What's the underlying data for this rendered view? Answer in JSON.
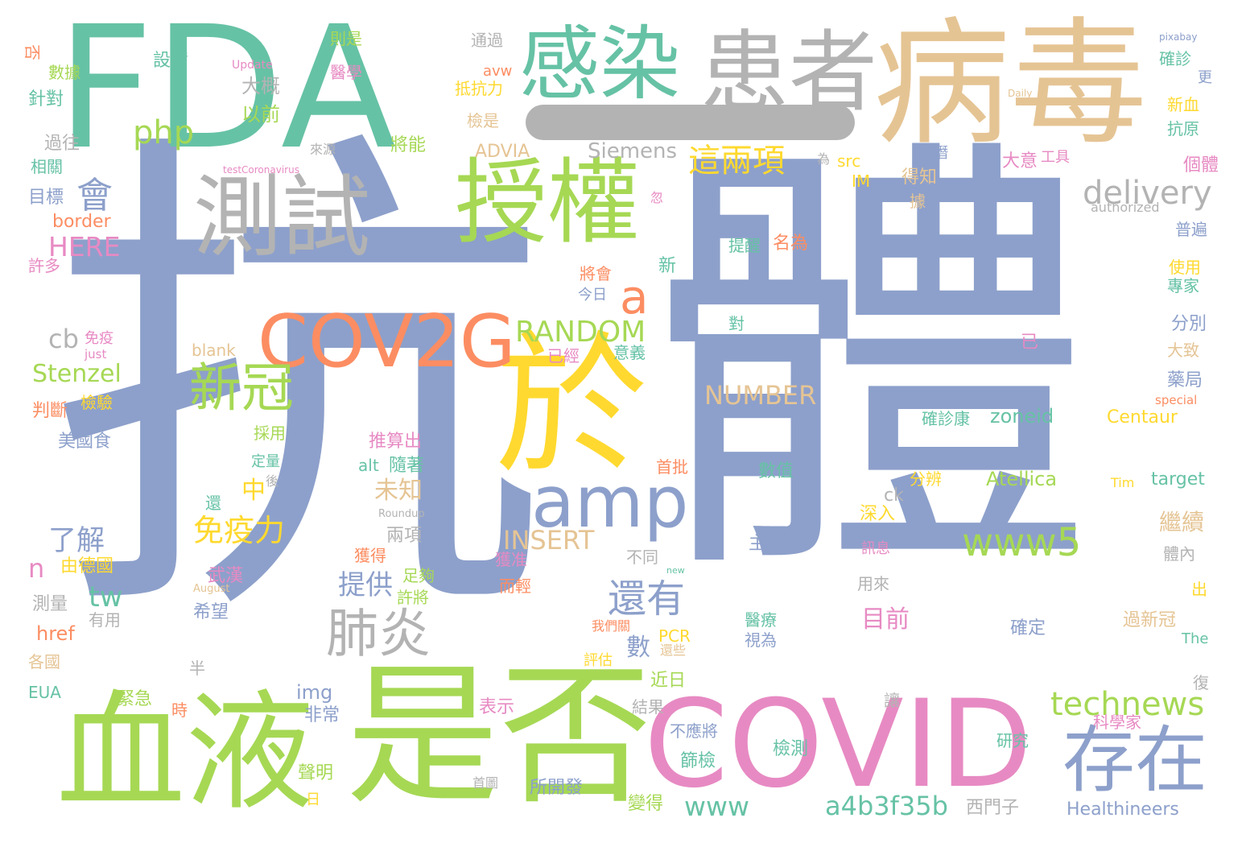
{
  "colors": {
    "blue": "#8da0cb",
    "teal": "#66c2a5",
    "tan": "#e5c494",
    "green": "#a6d854",
    "gray": "#b3b3b3",
    "yellow": "#ffd92f",
    "pink": "#e78ac3",
    "orange": "#fc8d62"
  },
  "words": [
    {
      "text": "抗",
      "color": "blue"
    },
    {
      "text": "體",
      "color": "blue"
    },
    {
      "text": "FDA",
      "color": "teal"
    },
    {
      "text": "病毒",
      "color": "tan"
    },
    {
      "text": "患者",
      "color": "gray"
    },
    {
      "text": "感染",
      "color": "teal"
    },
    {
      "text": "授權",
      "color": "green"
    },
    {
      "text": "測試",
      "color": "gray"
    },
    {
      "text": "於",
      "color": "yellow"
    },
    {
      "text": "是否",
      "color": "green"
    },
    {
      "text": "血液",
      "color": "green"
    },
    {
      "text": "COVID",
      "color": "pink"
    },
    {
      "text": "存在",
      "color": "blue"
    },
    {
      "text": "COV2G",
      "color": "orange"
    },
    {
      "text": "amp",
      "color": "blue"
    },
    {
      "text": "新冠",
      "color": "green"
    },
    {
      "text": "肺炎",
      "color": "gray"
    },
    {
      "text": "php",
      "color": "green"
    },
    {
      "text": "這兩項",
      "color": "yellow"
    },
    {
      "text": "delivery",
      "color": "gray"
    },
    {
      "text": "會",
      "color": "blue"
    },
    {
      "text": "a",
      "color": "orange"
    },
    {
      "text": "RANDOM",
      "color": "green"
    },
    {
      "text": "www5",
      "color": "green"
    },
    {
      "text": "還有",
      "color": "blue"
    },
    {
      "text": "technews",
      "color": "green"
    },
    {
      "text": "a4b3f35b",
      "color": "teal"
    },
    {
      "text": "www",
      "color": "teal"
    },
    {
      "text": "HERE",
      "color": "pink"
    },
    {
      "text": "Stenzel",
      "color": "green"
    },
    {
      "text": "NUMBER",
      "color": "tan"
    },
    {
      "text": "INSERT",
      "color": "tan"
    },
    {
      "text": "免疫力",
      "color": "yellow"
    },
    {
      "text": "提供",
      "color": "blue"
    },
    {
      "text": "未知",
      "color": "tan"
    },
    {
      "text": "目前",
      "color": "pink"
    },
    {
      "text": "繼續",
      "color": "tan"
    },
    {
      "text": "tw",
      "color": "teal"
    },
    {
      "text": "了解",
      "color": "blue"
    },
    {
      "text": "cb",
      "color": "gray"
    },
    {
      "text": "n",
      "color": "pink"
    },
    {
      "text": "數",
      "color": "blue"
    },
    {
      "text": "中",
      "color": "yellow"
    },
    {
      "text": "Siemens",
      "color": "gray"
    },
    {
      "text": "zoneid",
      "color": "teal"
    },
    {
      "text": "Centaur",
      "color": "yellow"
    },
    {
      "text": "Atellica",
      "color": "green"
    },
    {
      "text": "target",
      "color": "teal"
    },
    {
      "text": "Healthineers",
      "color": "blue"
    },
    {
      "text": "ADVIA",
      "color": "tan"
    },
    {
      "text": "border",
      "color": "orange"
    },
    {
      "text": "blank",
      "color": "tan"
    },
    {
      "text": "img",
      "color": "blue"
    },
    {
      "text": "href",
      "color": "orange"
    },
    {
      "text": "alt",
      "color": "teal"
    },
    {
      "text": "src",
      "color": "yellow"
    },
    {
      "text": "IM",
      "color": "yellow"
    },
    {
      "text": "EUA",
      "color": "teal"
    },
    {
      "text": "PCR",
      "color": "yellow"
    },
    {
      "text": "ck",
      "color": "gray"
    },
    {
      "text": "avw",
      "color": "orange"
    },
    {
      "text": "The",
      "color": "teal"
    },
    {
      "text": "Tim",
      "color": "yellow"
    },
    {
      "text": "authorized",
      "color": "gray"
    },
    {
      "text": "just",
      "color": "pink"
    },
    {
      "text": "special",
      "color": "orange"
    },
    {
      "text": "Update",
      "color": "pink"
    },
    {
      "text": "pixabay",
      "color": "blue"
    },
    {
      "text": "Daily",
      "color": "tan"
    },
    {
      "text": "testCoronavirus",
      "color": "pink"
    },
    {
      "text": "Roundup",
      "color": "gray"
    },
    {
      "text": "August",
      "color": "tan"
    },
    {
      "text": "new",
      "color": "teal"
    },
    {
      "text": "設備",
      "color": "teal"
    },
    {
      "text": "數據",
      "color": "green"
    },
    {
      "text": "否",
      "color": "orange"
    },
    {
      "text": "針對",
      "color": "teal"
    },
    {
      "text": "過往",
      "color": "gray"
    },
    {
      "text": "相關",
      "color": "teal"
    },
    {
      "text": "目標",
      "color": "blue"
    },
    {
      "text": "許多",
      "color": "pink"
    },
    {
      "text": "則是",
      "color": "green"
    },
    {
      "text": "醫學",
      "color": "pink"
    },
    {
      "text": "大概",
      "color": "gray"
    },
    {
      "text": "以前",
      "color": "green"
    },
    {
      "text": "來源",
      "color": "gray"
    },
    {
      "text": "通過",
      "color": "gray"
    },
    {
      "text": "抵抗力",
      "color": "yellow"
    },
    {
      "text": "檢是",
      "color": "tan"
    },
    {
      "text": "將能",
      "color": "green"
    },
    {
      "text": "確診",
      "color": "teal"
    },
    {
      "text": "更",
      "color": "blue"
    },
    {
      "text": "新血",
      "color": "yellow"
    },
    {
      "text": "抗原",
      "color": "teal"
    },
    {
      "text": "潛",
      "color": "blue"
    },
    {
      "text": "為",
      "color": "gray"
    },
    {
      "text": "大意",
      "color": "pink"
    },
    {
      "text": "工具",
      "color": "pink"
    },
    {
      "text": "得知",
      "color": "tan"
    },
    {
      "text": "據",
      "color": "tan"
    },
    {
      "text": "忽",
      "color": "pink"
    },
    {
      "text": "個體",
      "color": "pink"
    },
    {
      "text": "普遍",
      "color": "blue"
    },
    {
      "text": "使用",
      "color": "yellow"
    },
    {
      "text": "專家",
      "color": "teal"
    },
    {
      "text": "分別",
      "color": "blue"
    },
    {
      "text": "大致",
      "color": "tan"
    },
    {
      "text": "藥局",
      "color": "blue"
    },
    {
      "text": "提醒",
      "color": "teal"
    },
    {
      "text": "名為",
      "color": "orange"
    },
    {
      "text": "新",
      "color": "teal"
    },
    {
      "text": "將會",
      "color": "orange"
    },
    {
      "text": "今日",
      "color": "blue"
    },
    {
      "text": "對",
      "color": "teal"
    },
    {
      "text": "已經",
      "color": "pink"
    },
    {
      "text": "意義",
      "color": "teal"
    },
    {
      "text": "已",
      "color": "pink"
    },
    {
      "text": "免疫",
      "color": "pink"
    },
    {
      "text": "判斷",
      "color": "orange"
    },
    {
      "text": "檢驗",
      "color": "yellow"
    },
    {
      "text": "美國食",
      "color": "blue"
    },
    {
      "text": "採用",
      "color": "green"
    },
    {
      "text": "定量",
      "color": "teal"
    },
    {
      "text": "後",
      "color": "gray"
    },
    {
      "text": "推算出",
      "color": "pink"
    },
    {
      "text": "隨著",
      "color": "teal"
    },
    {
      "text": "首批",
      "color": "orange"
    },
    {
      "text": "數值",
      "color": "teal"
    },
    {
      "text": "確診康",
      "color": "teal"
    },
    {
      "text": "分辨",
      "color": "yellow"
    },
    {
      "text": "深入",
      "color": "yellow"
    },
    {
      "text": "還",
      "color": "teal"
    },
    {
      "text": "主要",
      "color": "blue"
    },
    {
      "text": "兩項",
      "color": "gray"
    },
    {
      "text": "不同",
      "color": "gray"
    },
    {
      "text": "訊息",
      "color": "pink"
    },
    {
      "text": "體內",
      "color": "gray"
    },
    {
      "text": "獲得",
      "color": "orange"
    },
    {
      "text": "獲准",
      "color": "pink"
    },
    {
      "text": "由德國",
      "color": "yellow"
    },
    {
      "text": "武漢",
      "color": "pink"
    },
    {
      "text": "足夠",
      "color": "green"
    },
    {
      "text": "許將",
      "color": "green"
    },
    {
      "text": "而輕",
      "color": "orange"
    },
    {
      "text": "用來",
      "color": "gray"
    },
    {
      "text": "出",
      "color": "yellow"
    },
    {
      "text": "測量",
      "color": "gray"
    },
    {
      "text": "有用",
      "color": "gray"
    },
    {
      "text": "希望",
      "color": "blue"
    },
    {
      "text": "我們關",
      "color": "orange"
    },
    {
      "text": "還些",
      "color": "tan"
    },
    {
      "text": "醫療",
      "color": "teal"
    },
    {
      "text": "視為",
      "color": "blue"
    },
    {
      "text": "確定",
      "color": "blue"
    },
    {
      "text": "過新冠",
      "color": "tan"
    },
    {
      "text": "各國",
      "color": "tan"
    },
    {
      "text": "半",
      "color": "gray"
    },
    {
      "text": "評估",
      "color": "yellow"
    },
    {
      "text": "近日",
      "color": "green"
    },
    {
      "text": "緊急",
      "color": "green"
    },
    {
      "text": "時",
      "color": "orange"
    },
    {
      "text": "非常",
      "color": "blue"
    },
    {
      "text": "表示",
      "color": "pink"
    },
    {
      "text": "結果",
      "color": "gray"
    },
    {
      "text": "不應將",
      "color": "blue"
    },
    {
      "text": "篩檢",
      "color": "teal"
    },
    {
      "text": "讓",
      "color": "gray"
    },
    {
      "text": "科學家",
      "color": "pink"
    },
    {
      "text": "復",
      "color": "gray"
    },
    {
      "text": "研究",
      "color": "teal"
    },
    {
      "text": "檢測",
      "color": "teal"
    },
    {
      "text": "聲明",
      "color": "green"
    },
    {
      "text": "首圖",
      "color": "gray"
    },
    {
      "text": "所開發",
      "color": "blue"
    },
    {
      "text": "日",
      "color": "yellow"
    },
    {
      "text": "變得",
      "color": "green"
    },
    {
      "text": "西門子",
      "color": "gray"
    }
  ]
}
